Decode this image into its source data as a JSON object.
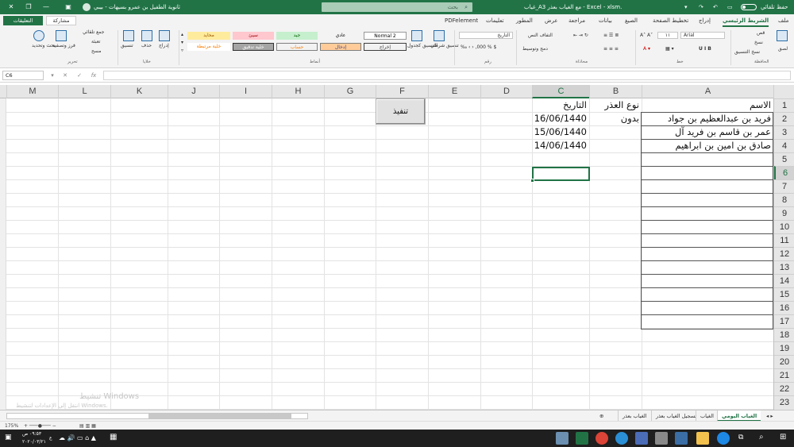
{
  "app": {
    "title": "غياب_A3 مع الغياب بعذر - Excel - xlsm.",
    "autosave_label": "حفظ تلقائي",
    "user_name": "ثانوية الطفيل بن عمرو بسيهات - بيبي",
    "search_placeholder": "بحث"
  },
  "tabs": [
    "ملف",
    "الشريط الرئيسي",
    "إدراج",
    "تخطيط الصفحة",
    "الصيغ",
    "بيانات",
    "مراجعة",
    "عرض",
    "المطور",
    "تعليمات",
    "PDFelement"
  ],
  "tabs_active": "الشريط الرئيسي",
  "share_label": "مشاركة",
  "comments_label": "التعليقات",
  "ribbon": {
    "groups": [
      "الحافظة",
      "خط",
      "محاذاة",
      "رقم",
      "أنماط",
      "خلايا",
      "تحرير"
    ],
    "clipboard": {
      "paste": "لصق",
      "cut": "قص",
      "copy": "نسخ",
      "format_painter": "نسخ التنسيق"
    },
    "font": {
      "name": "Arial",
      "size": "١١"
    },
    "alignment": {
      "wrap": "التفاف النص",
      "merge": "دمج وتوسيط"
    },
    "number": {
      "format": "التاريخ"
    },
    "styles": {
      "conditional": "تنسيق شرطي",
      "as_table": "التنسيق كجدول",
      "cells": [
        {
          "label": "Normal 2",
          "bg": "#ffffff",
          "fg": "#000000"
        },
        {
          "label": "عادي",
          "bg": "#f3f3f3",
          "fg": "#000000"
        },
        {
          "label": "جيد",
          "bg": "#c6efce",
          "fg": "#006100"
        },
        {
          "label": "سيئ",
          "bg": "#ffc7ce",
          "fg": "#9c0006"
        },
        {
          "label": "محايد",
          "bg": "#ffeb9c",
          "fg": "#9c5700"
        },
        {
          "label": "إخراج",
          "bg": "#f2f2f2",
          "fg": "#3f3f3f"
        },
        {
          "label": "إدخال",
          "bg": "#ffcc99",
          "fg": "#3f3f76"
        },
        {
          "label": "حساب",
          "bg": "#f2f2f2",
          "fg": "#fa7d00"
        },
        {
          "label": "خلية تدقيق",
          "bg": "#a5a5a5",
          "fg": "#ffffff"
        },
        {
          "label": "خلية مرتبطة",
          "bg": "#ffffff",
          "fg": "#fa7d00"
        }
      ]
    },
    "cells": {
      "insert": "إدراج",
      "delete": "حذف",
      "format": "تنسيق"
    },
    "editing": {
      "autosum": "جمع تلقائي",
      "fill": "تعبئة",
      "clear": "مسح",
      "sort": "فرز وتصفية",
      "find": "بحث وتحديد"
    }
  },
  "formula_bar": {
    "name_box": "C6",
    "fx": "fx",
    "value": ""
  },
  "columns": [
    "A",
    "B",
    "C",
    "D",
    "E",
    "F",
    "G",
    "H",
    "I",
    "J",
    "K",
    "L",
    "M"
  ],
  "selected_column": "C",
  "rows": [
    "1",
    "2",
    "3",
    "4",
    "5",
    "6",
    "7",
    "8",
    "9",
    "10",
    "11",
    "12",
    "13",
    "14",
    "15",
    "16",
    "17",
    "18",
    "19",
    "20",
    "21",
    "22",
    "23"
  ],
  "selected_row": "6",
  "cells": {
    "A1": "الاسم",
    "B1": "نوع العذر",
    "C1": "التاريخ",
    "A2": "فريد بن عبدالعظيم بن جواد",
    "B2": "بدون",
    "C2": "16/06/1440",
    "A3": "عمر بن قاسم بن فريد آل",
    "C3": "15/06/1440",
    "A4": "صادق بن امين بن ابراهيم",
    "C4": "14/06/1440"
  },
  "run_button_label": "تنفيذ",
  "watermark": {
    "line1": "تنشيط Windows",
    "line2": "انتقل إلى الإعدادات لتنشيط Windows."
  },
  "sheet_tabs": [
    "الغياب اليومي",
    "الغياب",
    "تسجيل الغياب بعذر",
    "الغياب بعذر"
  ],
  "active_sheet": "الغياب اليومي",
  "status": {
    "zoom": "175%"
  },
  "taskbar": {
    "time": "٠٩:٥٣ ص",
    "date": "٢٠٢٠/٠٣/٢١",
    "lang": "ع"
  }
}
